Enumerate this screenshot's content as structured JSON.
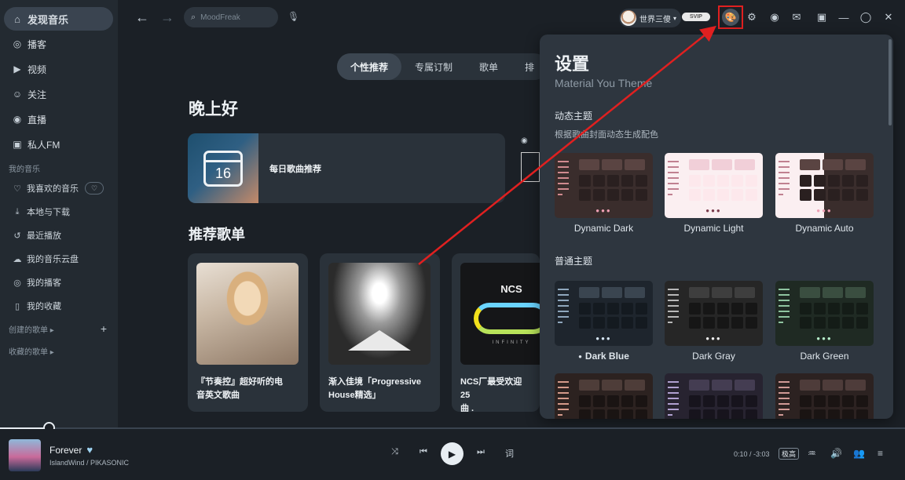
{
  "sidebar": {
    "nav": [
      {
        "label": "发现音乐",
        "icon": "home-icon",
        "glyph": "⌂",
        "active": true
      },
      {
        "label": "播客",
        "icon": "podcast-icon",
        "glyph": "◎"
      },
      {
        "label": "视频",
        "icon": "video-icon",
        "glyph": "▶"
      },
      {
        "label": "关注",
        "icon": "user-icon",
        "glyph": "☺"
      },
      {
        "label": "直播",
        "icon": "live-icon",
        "glyph": "◉"
      },
      {
        "label": "私人FM",
        "icon": "radio-icon",
        "glyph": "▣"
      }
    ],
    "my_music_title": "我的音乐",
    "my_music": [
      {
        "label": "我喜欢的音乐",
        "icon": "heart-icon",
        "glyph": "♡"
      },
      {
        "label": "本地与下载",
        "icon": "download-icon",
        "glyph": "⤓"
      },
      {
        "label": "最近播放",
        "icon": "history-icon",
        "glyph": "↺"
      },
      {
        "label": "我的音乐云盘",
        "icon": "cloud-icon",
        "glyph": "☁"
      },
      {
        "label": "我的播客",
        "icon": "podcast-icon",
        "glyph": "◎"
      },
      {
        "label": "我的收藏",
        "icon": "collection-icon",
        "glyph": "▯"
      }
    ],
    "created_playlists": "创建的歌单",
    "collected_playlists": "收藏的歌单"
  },
  "topbar": {
    "search_placeholder": "MoodFreak",
    "username": "世界三傻",
    "vip_badge": "SVIP"
  },
  "tabs": [
    {
      "label": "个性推荐",
      "active": true
    },
    {
      "label": "专属订制"
    },
    {
      "label": "歌单"
    },
    {
      "label": "排"
    }
  ],
  "main": {
    "greeting": "晚上好",
    "daily_day": "16",
    "daily_label": "每日歌曲推荐",
    "section_title": "推荐歌单",
    "playlists": [
      {
        "title": "『节奏控』超好听的电\n音英文歌曲",
        "art": "art1"
      },
      {
        "title": "渐入佳境「Progressive\nHouse精选」",
        "art": "art2"
      },
      {
        "title": "NCS厂最受欢迎25\n曲 .",
        "art": "art3",
        "logo": "NCS",
        "art_text": "INFINITY"
      }
    ]
  },
  "settings": {
    "title": "设置",
    "subtitle": "Material You Theme",
    "dynamic_title": "动态主题",
    "dynamic_desc": "根据歌曲封面动态生成配色",
    "dynamic_themes": [
      {
        "name": "Dynamic Dark",
        "bg": "#3a2d2c",
        "tile": "#5a4442",
        "cell": "#2a2020",
        "line": "#d08a8f",
        "dot": "#f0a0b4",
        "split": ""
      },
      {
        "name": "Dynamic Light",
        "bg": "#fbeff1",
        "tile": "#f1cfd8",
        "cell": "#fde8ec",
        "line": "#c08090",
        "dot": "#7a3a4a",
        "split": ""
      },
      {
        "name": "Dynamic Auto",
        "bg": "#3a2d2c",
        "tile": "#5a4442",
        "cell": "#2a2020",
        "line": "#c08090",
        "dot": "#f0a0b4",
        "split": "#fbeff1"
      }
    ],
    "normal_title": "普通主题",
    "normal_themes": [
      {
        "name": "Dark Blue",
        "bg": "#1e252d",
        "tile": "#3a4550",
        "cell": "#141a20",
        "line": "#8fa7bd",
        "dot": "#d6e6f5",
        "selected": true,
        "marker": "●"
      },
      {
        "name": "Dark Gray",
        "bg": "#262626",
        "tile": "#3e3e3e",
        "cell": "#161616",
        "line": "#b8b8b8",
        "dot": "#f0f0f0"
      },
      {
        "name": "Dark Green",
        "bg": "#1f2a23",
        "tile": "#3a4e40",
        "cell": "#141c17",
        "line": "#8fc4a0",
        "dot": "#b8f0cc"
      }
    ],
    "extra_themes": [
      {
        "bg": "#2c2220",
        "tile": "#4e3d39",
        "cell": "#1a1413",
        "line": "#d49a8a"
      },
      {
        "bg": "#272330",
        "tile": "#443d52",
        "cell": "#17141d",
        "line": "#b0a0d0"
      },
      {
        "bg": "#2c2221",
        "tile": "#4e3c3a",
        "cell": "#1a1413",
        "line": "#d09a96"
      }
    ]
  },
  "player": {
    "song": "Forever",
    "artist": "IslandWind / PIKASONIC",
    "time": "0:10 / -3:03",
    "quality": "极高",
    "lyric_btn": "词"
  },
  "colors": {
    "accent": "#e02020",
    "annotation_arrow": "#e02020"
  }
}
